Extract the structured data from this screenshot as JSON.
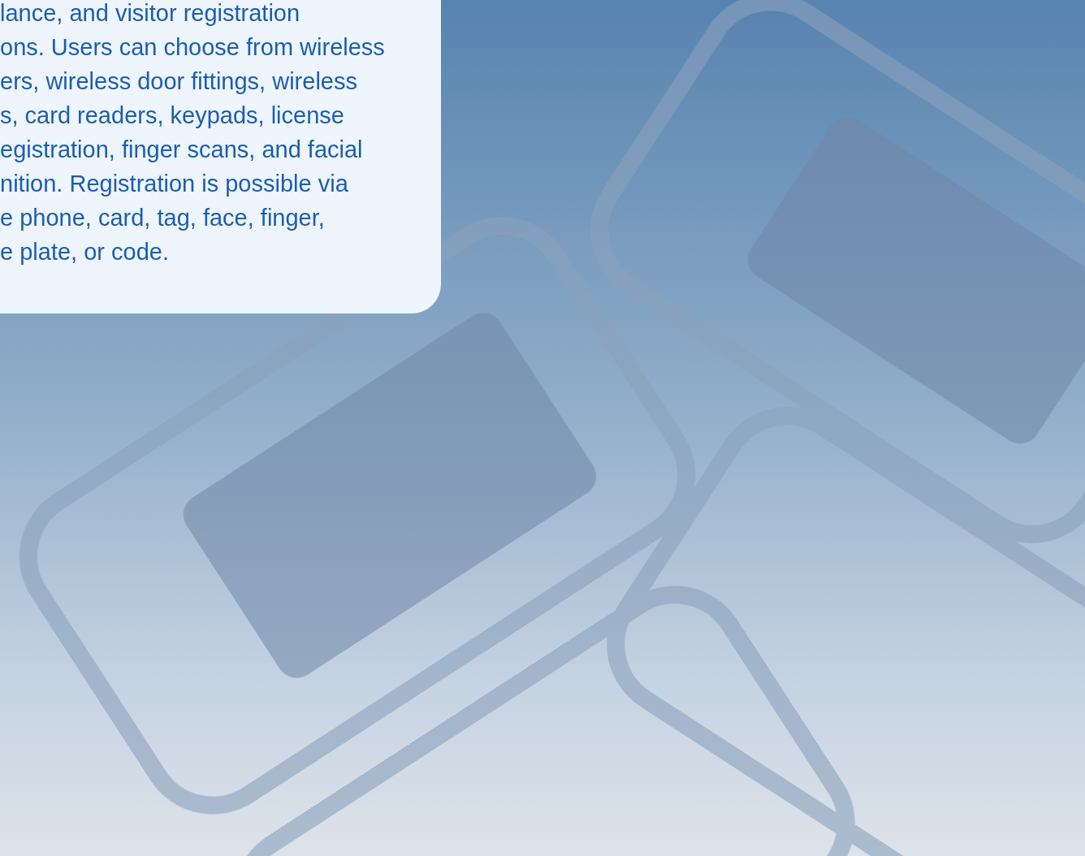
{
  "info_card": {
    "lines": [
      "lance, and visitor registration",
      "ons. Users can choose from wireless",
      "ers, wireless door fittings, wireless",
      "s, card readers, keypads, license",
      "egistration, finger scans, and facial",
      "nition. Registration is possible via",
      "e phone, card, tag, face, finger,",
      "e plate, or code."
    ]
  }
}
